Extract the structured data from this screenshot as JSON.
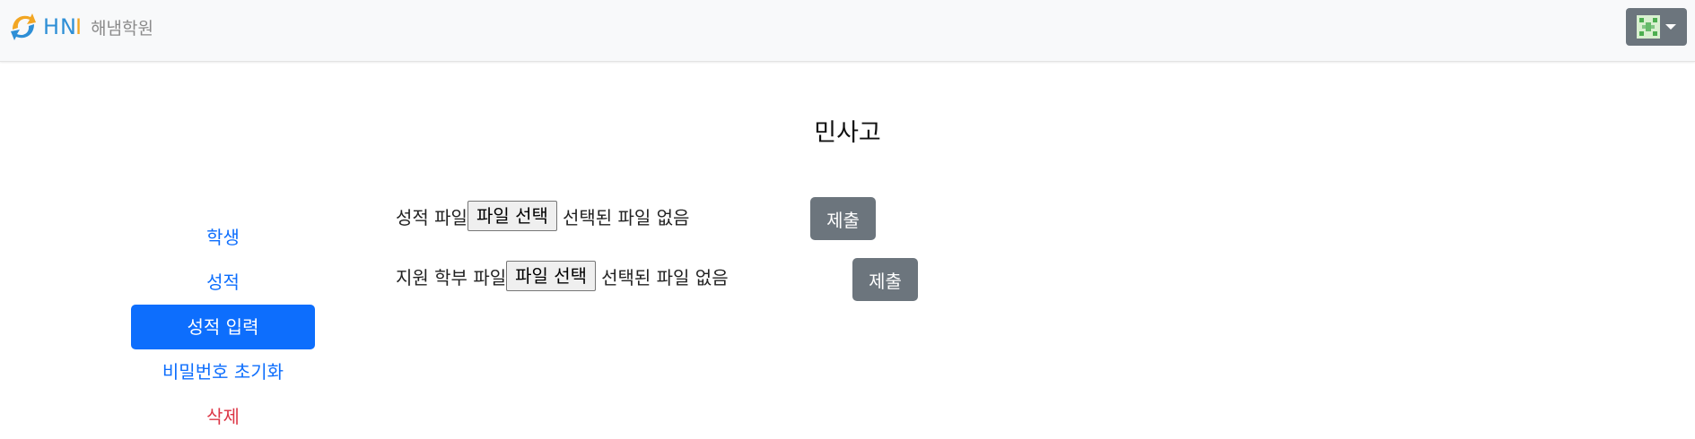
{
  "navbar": {
    "brand_hni": "HN",
    "brand_bar": "I",
    "brand_name": "해냄학원",
    "user_menu_icon": "avatar-icon"
  },
  "page": {
    "title": "민사고"
  },
  "sidebar": {
    "items": [
      {
        "label": "학생",
        "state": "link"
      },
      {
        "label": "성적",
        "state": "link"
      },
      {
        "label": "성적 입력",
        "state": "active"
      },
      {
        "label": "비밀번호 초기화",
        "state": "link"
      },
      {
        "label": "삭제",
        "state": "danger"
      }
    ]
  },
  "forms": [
    {
      "label": "성적 파일",
      "file_button": "파일 선택",
      "file_status": "선택된 파일 없음",
      "submit": "제출"
    },
    {
      "label": "지원 학부 파일",
      "file_button": "파일 선택",
      "file_status": "선택된 파일 없음",
      "submit": "제출"
    }
  ],
  "colors": {
    "primary": "#0d6efd",
    "secondary": "#6c757d",
    "danger": "#dc3545",
    "navbar_bg": "#f8f9fa"
  }
}
